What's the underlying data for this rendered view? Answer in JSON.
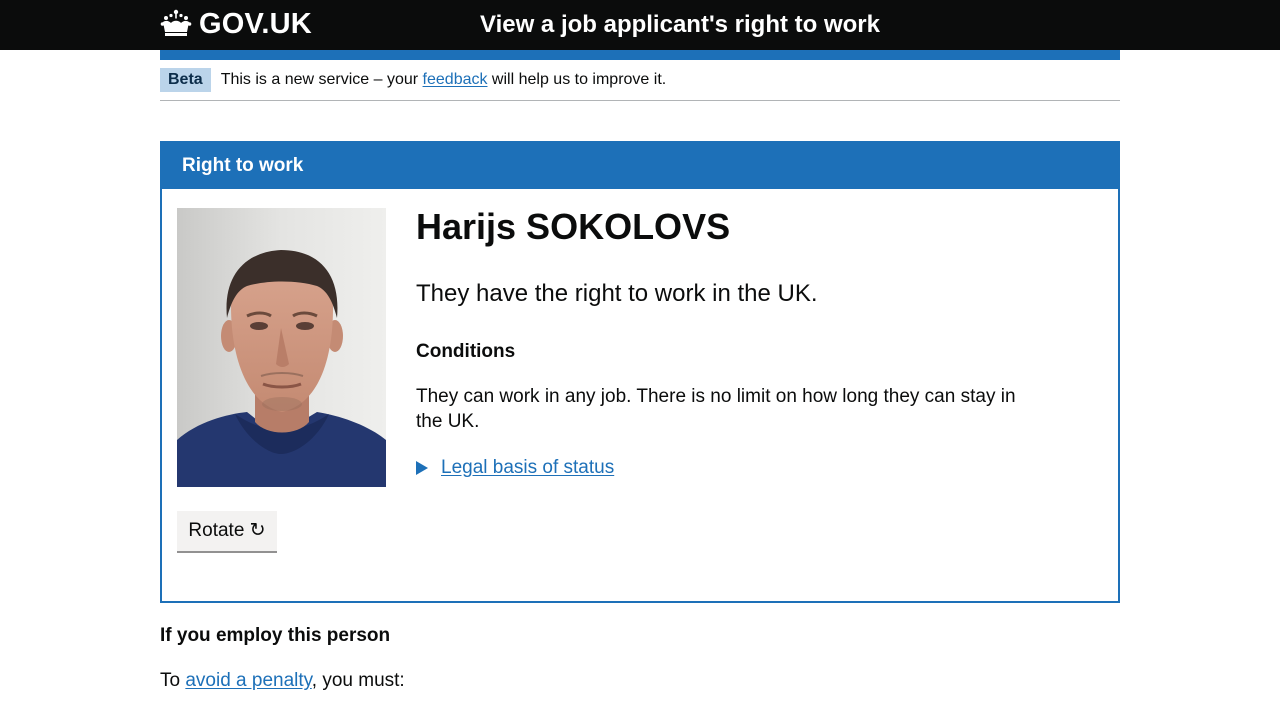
{
  "header": {
    "logo_text": "GOV.UK",
    "service_name": "View a job applicant's right to work"
  },
  "phase_banner": {
    "tag": "Beta",
    "text_before": "This is a new service – your ",
    "link_text": "feedback",
    "text_after": " will help us to improve it."
  },
  "card": {
    "title": "Right to work",
    "name": "Harijs SOKOLOVS",
    "status": "They have the right to work in the UK.",
    "conditions_heading": "Conditions",
    "conditions_text": "They can work in any job. There is no limit on how long they can stay in the UK.",
    "details_link": "Legal basis of status",
    "rotate_label": "Rotate ↻"
  },
  "employ": {
    "heading": "If you employ this person",
    "penalty_before": "To ",
    "penalty_link": "avoid a penalty",
    "penalty_after": ", you must:"
  },
  "colors": {
    "header_bg": "#0b0c0c",
    "brand_blue": "#1d70b8",
    "beta_tag_bg": "#bbd4ea",
    "link": "#1d70b8"
  }
}
